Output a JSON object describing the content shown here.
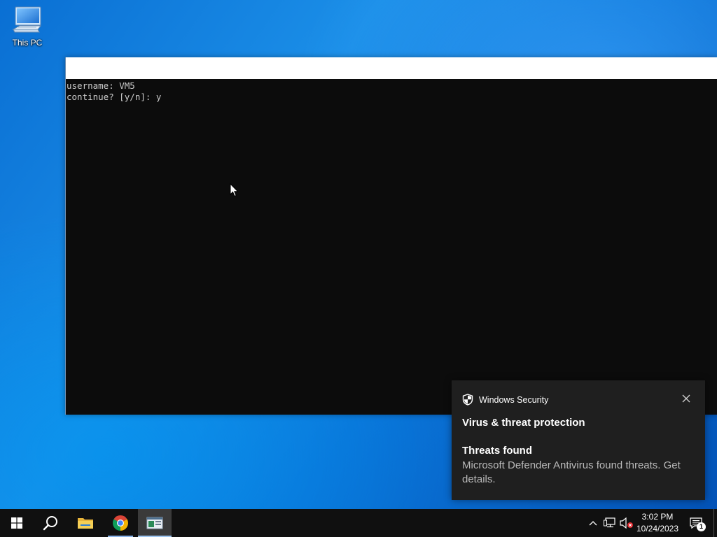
{
  "desktop": {
    "icons": [
      {
        "label": "This PC",
        "icon": "this-pc-icon"
      }
    ]
  },
  "console": {
    "title": "",
    "lines": [
      "username: VM5",
      "continue? [y/n]: y"
    ]
  },
  "toast": {
    "app_name": "Windows Security",
    "title": "Virus & threat protection",
    "subtitle": "Threats found",
    "message": "Microsoft Defender Antivirus found threats. Get details.",
    "icons": {
      "app": "shield-icon",
      "close": "close-icon"
    }
  },
  "taskbar": {
    "items": [
      {
        "name": "start",
        "icon": "windows-logo-icon"
      },
      {
        "name": "search",
        "icon": "search-icon"
      },
      {
        "name": "file-explorer",
        "icon": "folder-icon"
      },
      {
        "name": "chrome",
        "icon": "chrome-icon"
      },
      {
        "name": "console",
        "icon": "console-app-icon",
        "active": true
      }
    ],
    "tray": {
      "icons": [
        "chevron-up-icon",
        "network-icon",
        "volume-muted-icon"
      ],
      "time": "3:02 PM",
      "date": "10/24/2023",
      "notification_count": "1"
    }
  },
  "colors": {
    "taskbar": "#101010",
    "console_bg": "#0c0c0c",
    "console_text": "#cccccc",
    "toast_bg": "#1f1f1f",
    "accent": "#8ab4e8"
  }
}
